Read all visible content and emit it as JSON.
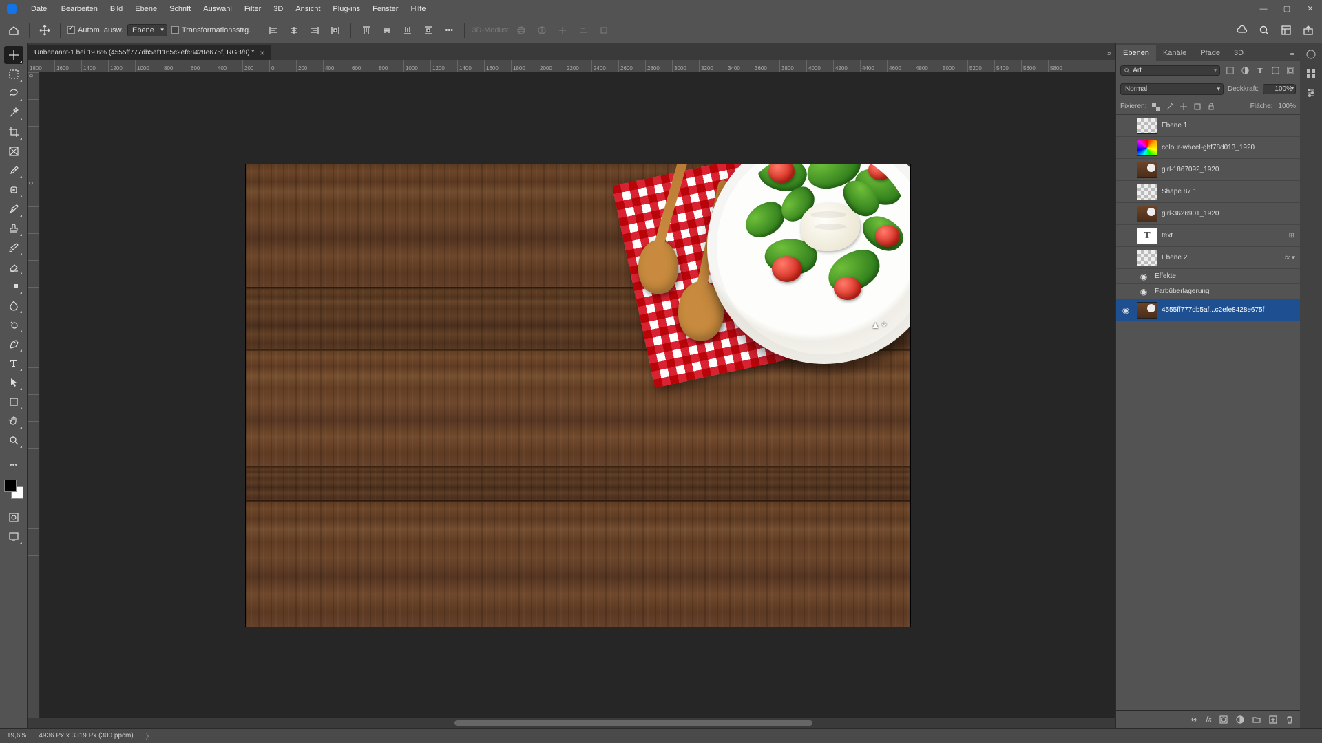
{
  "menu": [
    "Datei",
    "Bearbeiten",
    "Bild",
    "Ebene",
    "Schrift",
    "Auswahl",
    "Filter",
    "3D",
    "Ansicht",
    "Plug-ins",
    "Fenster",
    "Hilfe"
  ],
  "options": {
    "auto_select": "Autom. ausw.",
    "target": "Ebene",
    "transform": "Transformationsstrg.",
    "mode3d": "3D-Modus:"
  },
  "tab": {
    "title": "Unbenannt-1 bei 19,6% (4555ff777db5af1165c2efe8428e675f, RGB/8) *"
  },
  "rulerH": [
    "1800",
    "1600",
    "1400",
    "1200",
    "1000",
    "800",
    "600",
    "400",
    "200",
    "0",
    "200",
    "400",
    "600",
    "800",
    "1000",
    "1200",
    "1400",
    "1600",
    "1800",
    "2000",
    "2200",
    "2400",
    "2600",
    "2800",
    "3000",
    "3200",
    "3400",
    "3600",
    "3800",
    "4000",
    "4200",
    "4400",
    "4600",
    "4800",
    "5000",
    "5200",
    "5400",
    "5600",
    "5800"
  ],
  "rulerV": [
    "0",
    "",
    "",
    "",
    "0",
    "",
    "",
    "",
    "",
    "",
    "",
    "",
    "",
    "",
    "",
    "",
    "",
    "",
    ""
  ],
  "panel": {
    "tabs": [
      "Ebenen",
      "Kanäle",
      "Pfade",
      "3D"
    ],
    "search_ph": "Art",
    "blend": "Normal",
    "opacity_lbl": "Deckkraft:",
    "opacity": "100%",
    "lock_lbl": "Fixieren:",
    "fill_lbl": "Fläche:",
    "fill": "100%"
  },
  "layers": [
    {
      "vis": false,
      "thumb": "checker",
      "name": "Ebene 1"
    },
    {
      "vis": false,
      "thumb": "wheel",
      "name": "colour-wheel-gbf78d013_1920"
    },
    {
      "vis": false,
      "thumb": "img",
      "name": "girl-1867092_1920"
    },
    {
      "vis": false,
      "thumb": "checker",
      "name": "Shape 87 1"
    },
    {
      "vis": false,
      "thumb": "img",
      "name": "girl-3626901_1920"
    },
    {
      "vis": false,
      "thumb": "txt",
      "name": "text",
      "badge": "⊞"
    },
    {
      "vis": false,
      "thumb": "checker",
      "name": "Ebene 2",
      "fx": "fx ▾"
    }
  ],
  "effects": {
    "label": "Effekte",
    "item": "Farbüberlagerung"
  },
  "selected_layer": {
    "name": "4555ff777db5af...c2efe8428e675f"
  },
  "status": {
    "zoom": "19,6%",
    "dims": "4936 Px x 3319 Px (300 ppcm)"
  }
}
